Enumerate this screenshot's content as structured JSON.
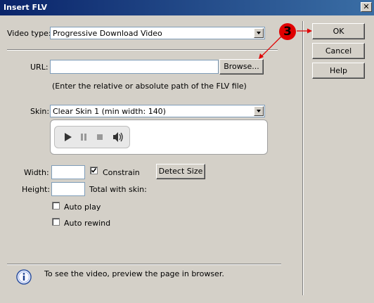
{
  "dialog": {
    "title": "Insert FLV",
    "close_glyph": "✕"
  },
  "video_type": {
    "label": "Video type:",
    "value": "Progressive Download Video"
  },
  "url": {
    "label": "URL:",
    "value": "",
    "browse_label": "Browse...",
    "hint": "(Enter the relative or absolute path of the FLV file)"
  },
  "skin": {
    "label": "Skin:",
    "value": "Clear Skin 1 (min width: 140)"
  },
  "player_icons": [
    "play-icon",
    "pause-icon",
    "stop-icon",
    "volume-icon"
  ],
  "size": {
    "width_label": "Width:",
    "width_value": "",
    "height_label": "Height:",
    "height_value": "",
    "constrain_label": "Constrain",
    "constrain_checked": true,
    "total_label": "Total with skin:",
    "detect_label": "Detect Size"
  },
  "options": {
    "auto_play_label": "Auto play",
    "auto_rewind_label": "Auto rewind"
  },
  "info": {
    "text": "To see the video, preview the page in browser."
  },
  "buttons": {
    "ok": "OK",
    "cancel": "Cancel",
    "help": "Help"
  },
  "annotation": {
    "number": "3",
    "color": "#e00000"
  }
}
